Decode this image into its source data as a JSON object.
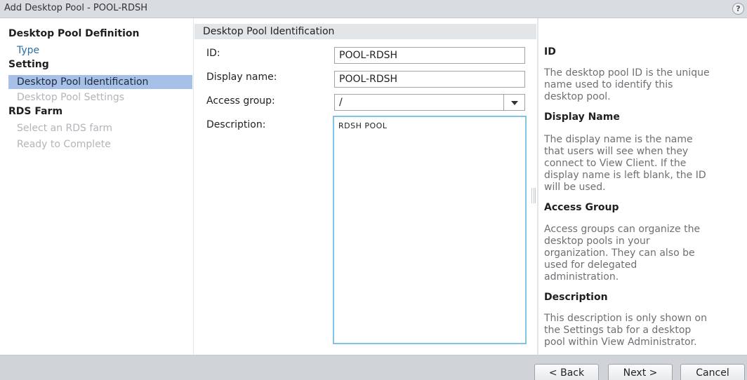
{
  "window": {
    "title": "Add Desktop Pool - POOL-RDSH",
    "help_glyph": "?"
  },
  "nav": {
    "sections": [
      {
        "label": "Desktop Pool Definition"
      },
      {
        "label": "Setting"
      },
      {
        "label": "RDS Farm"
      }
    ],
    "items": [
      {
        "label": "Type",
        "state": "link"
      },
      {
        "label": "Desktop Pool Identification",
        "state": "active"
      },
      {
        "label": "Desktop Pool Settings",
        "state": "disabled"
      },
      {
        "label": "Select an RDS farm",
        "state": "disabled"
      },
      {
        "label": "Ready to Complete",
        "state": "disabled"
      }
    ]
  },
  "form": {
    "heading": "Desktop Pool Identification",
    "id": {
      "label": "ID:",
      "value": "POOL-RDSH"
    },
    "display_name": {
      "label": "Display name:",
      "value": "POOL-RDSH"
    },
    "access_group": {
      "label": "Access group:",
      "value": "/"
    },
    "description": {
      "label": "Description:",
      "value": "RDSH POOL"
    }
  },
  "help": {
    "sections": [
      {
        "title": "ID",
        "body": "The desktop pool ID is the unique\nname used to identify this\ndesktop pool."
      },
      {
        "title": "Display Name",
        "body": "The display name is the name\nthat users will see when they\nconnect to View Client. If the\ndisplay name is left blank, the ID\nwill be used."
      },
      {
        "title": "Access Group",
        "body": "Access groups can organize the\ndesktop pools in your\norganization. They can also be\nused for delegated\nadministration."
      },
      {
        "title": "Description",
        "body": "This description is only shown on\nthe Settings tab for a desktop\npool within View Administrator."
      }
    ]
  },
  "footer": {
    "back_label": "< Back",
    "next_label": "Next >",
    "cancel_label": "Cancel"
  },
  "colors": {
    "active_nav": "#a7c0e8",
    "link": "#2c6ea8",
    "focus_border": "#7fc3e6",
    "titlebar": "#d9dde2",
    "footer": "#d0d4d9"
  }
}
